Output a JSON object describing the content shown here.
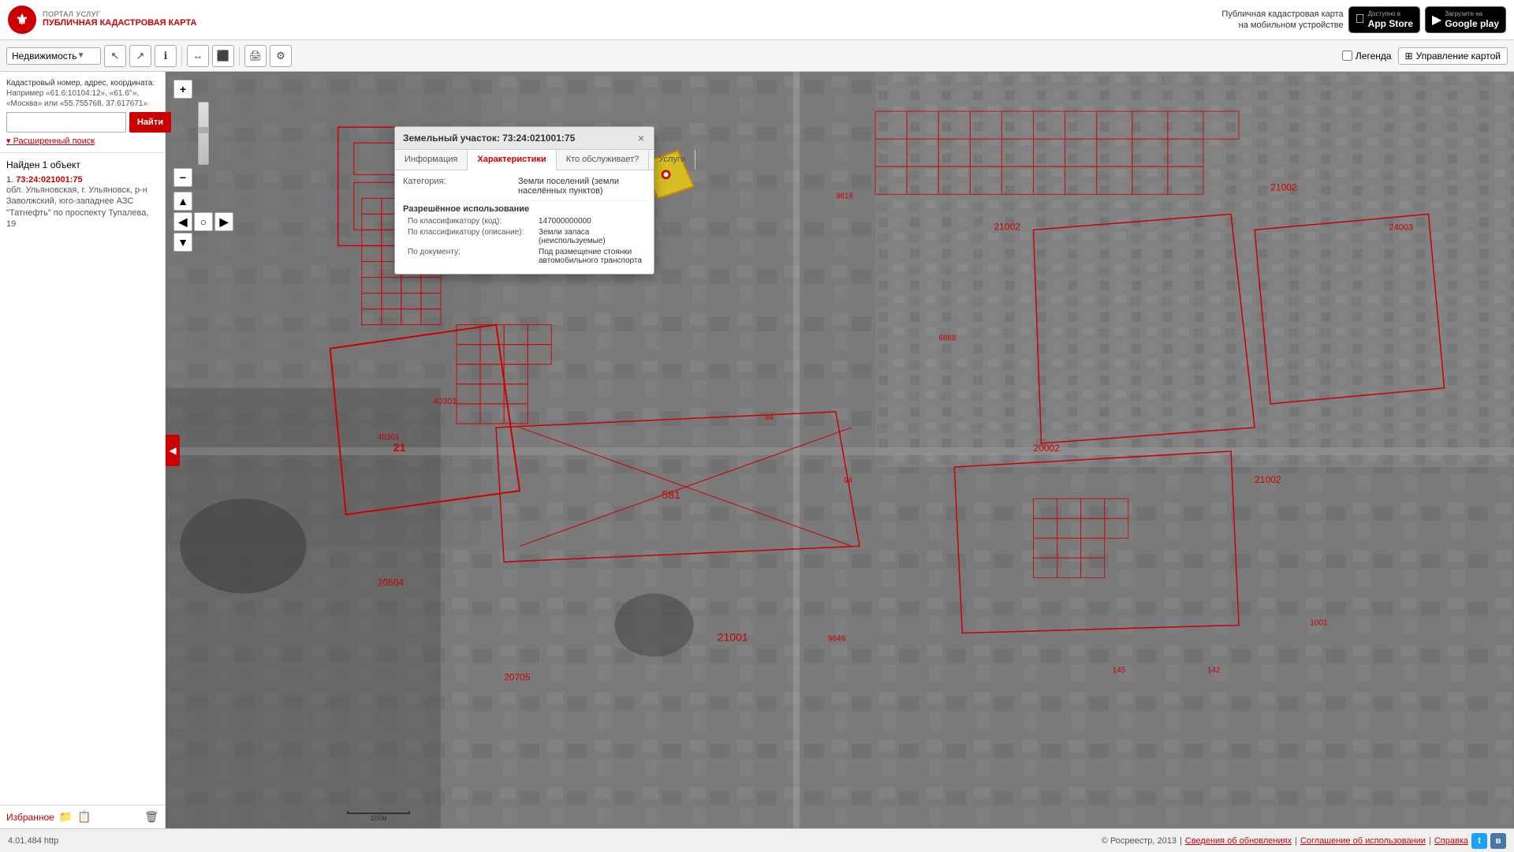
{
  "header": {
    "portal_label": "ПОРТАЛ УСЛУГ",
    "site_title": "ПУБЛИЧНАЯ КАДАСТРОВАЯ КАРТА",
    "mobile_promo_text": "Публичная кадастровая карта\nна мобильном устройстве",
    "appstore_available": "Доступно в",
    "appstore_name": "App Store",
    "googleplay_available": "Загрузите на",
    "googleplay_name": "Google play"
  },
  "toolbar": {
    "layer_select": "Недвижимость",
    "legend_label": "Легенда",
    "map_manage_label": "Управление картой"
  },
  "search": {
    "hint_line1": "Кадастровый номер, адрес, координата:",
    "hint_line2": "Например «61.6:10104:12», «61.6°»,",
    "hint_line3": "«Москва» или «55.755768, 37.617671»",
    "input_value": "",
    "input_placeholder": "",
    "search_btn_label": "Найти",
    "advanced_search_label": "▾ Расширенный поиск",
    "results_count": "Найден 1 объект",
    "results": [
      {
        "num": "1.",
        "id": "73:24:021001:75",
        "address": "обл. Ульяновская, г. Ульяновск, р-н Заволжский, юго-западнее АЗС \"Татнефть\" по проспекту Тупалева, 19"
      }
    ],
    "favorites_label": "Избранное"
  },
  "popup": {
    "title": "Земельный участок: 73:24:021001:75",
    "close_label": "×",
    "tabs": [
      {
        "label": "Информация",
        "active": false
      },
      {
        "label": "Характеристики",
        "active": true
      },
      {
        "label": "Кто обслуживает?",
        "active": false
      },
      {
        "label": "Услуги",
        "active": false
      }
    ],
    "category_label": "Категория:",
    "category_value": "Земли поселений (земли населённых пунктов)",
    "permitted_use_title": "Разрешённое использование",
    "classifier_code_label": "По классификатору (код):",
    "classifier_code_value": "147000000000",
    "classifier_desc_label": "По классификатору (описание):",
    "classifier_desc_value": "Земли запаса (неиспользуемые)",
    "by_doc_label": "По документу:",
    "by_doc_value": "Под размещение стоянки автомобильного транспорта"
  },
  "statusbar": {
    "version": "4.01.484",
    "protocol": "http",
    "copyright": "© Росреестр, 2013",
    "updates_link": "Сведения об обновлениях",
    "license_link": "Соглашение об использовании",
    "help_link": "Справка",
    "separator": "|"
  },
  "map": {
    "scale_label": "100м"
  },
  "icons": {
    "zoom_in": "+",
    "zoom_out": "−",
    "pan": "✋",
    "select_rect": "⬜",
    "measure": "📏",
    "info": "ℹ",
    "print": "🖨",
    "settings": "⚙",
    "arrow_right_collapse": "◀",
    "star_empty": "☆",
    "fav_add": "📁",
    "fav_add2": "📋",
    "trash": "🗑",
    "chevron_down": "▼",
    "grid": "⊞"
  },
  "colors": {
    "red": "#cc0000",
    "header_bg": "#ffffff",
    "toolbar_bg": "#f5f5f5",
    "panel_bg": "rgba(255,255,255,0.95)",
    "popup_header_bg": "#e8e8e8",
    "statusbar_bg": "#f0f0f0",
    "accent": "#cc0000",
    "cadastral_outline": "#cc0000"
  }
}
